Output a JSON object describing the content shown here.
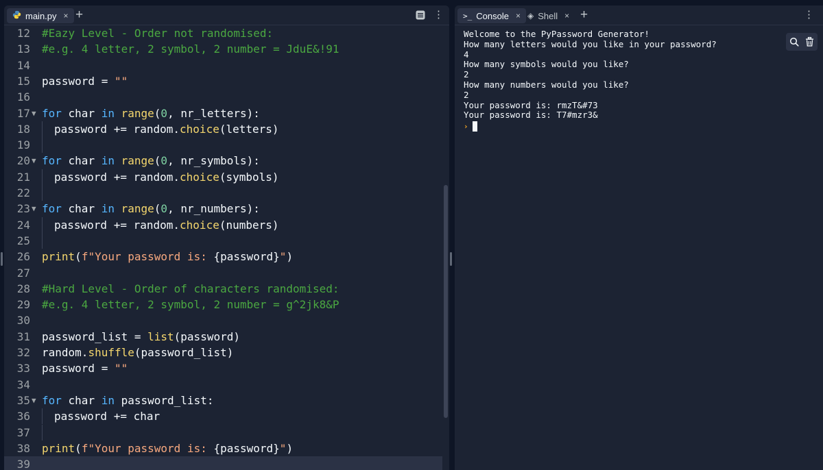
{
  "editor": {
    "tab_label": "main.py",
    "close_glyph": "×",
    "add_glyph": "+",
    "menu_glyph": "⋮",
    "icons": {
      "file": "python-icon",
      "panel": "list-panel-icon"
    },
    "lines": [
      {
        "n": "12",
        "fold": false,
        "indent": 0,
        "tokens": [
          [
            "comment",
            "#Eazy Level - Order not randomised:"
          ]
        ]
      },
      {
        "n": "13",
        "fold": false,
        "indent": 0,
        "tokens": [
          [
            "comment",
            "#e.g. 4 letter, 2 symbol, 2 number = JduE&!91"
          ]
        ]
      },
      {
        "n": "14",
        "fold": false,
        "indent": 0,
        "tokens": []
      },
      {
        "n": "15",
        "fold": false,
        "indent": 0,
        "tokens": [
          [
            "plain",
            "password = "
          ],
          [
            "str",
            "\"\""
          ]
        ]
      },
      {
        "n": "16",
        "fold": false,
        "indent": 0,
        "tokens": []
      },
      {
        "n": "17",
        "fold": true,
        "indent": 0,
        "tokens": [
          [
            "kw",
            "for"
          ],
          [
            "plain",
            " char "
          ],
          [
            "kw",
            "in"
          ],
          [
            "plain",
            " "
          ],
          [
            "fn",
            "range"
          ],
          [
            "plain",
            "("
          ],
          [
            "num",
            "0"
          ],
          [
            "plain",
            ", nr_letters):"
          ]
        ]
      },
      {
        "n": "18",
        "fold": false,
        "indent": 1,
        "tokens": [
          [
            "plain",
            "password += random."
          ],
          [
            "fn",
            "choice"
          ],
          [
            "plain",
            "(letters)"
          ]
        ]
      },
      {
        "n": "19",
        "fold": false,
        "indent": 1,
        "tokens": []
      },
      {
        "n": "20",
        "fold": true,
        "indent": 0,
        "tokens": [
          [
            "kw",
            "for"
          ],
          [
            "plain",
            " char "
          ],
          [
            "kw",
            "in"
          ],
          [
            "plain",
            " "
          ],
          [
            "fn",
            "range"
          ],
          [
            "plain",
            "("
          ],
          [
            "num",
            "0"
          ],
          [
            "plain",
            ", nr_symbols):"
          ]
        ]
      },
      {
        "n": "21",
        "fold": false,
        "indent": 1,
        "tokens": [
          [
            "plain",
            "password += random."
          ],
          [
            "fn",
            "choice"
          ],
          [
            "plain",
            "(symbols)"
          ]
        ]
      },
      {
        "n": "22",
        "fold": false,
        "indent": 1,
        "tokens": []
      },
      {
        "n": "23",
        "fold": true,
        "indent": 0,
        "tokens": [
          [
            "kw",
            "for"
          ],
          [
            "plain",
            " char "
          ],
          [
            "kw",
            "in"
          ],
          [
            "plain",
            " "
          ],
          [
            "fn",
            "range"
          ],
          [
            "plain",
            "("
          ],
          [
            "num",
            "0"
          ],
          [
            "plain",
            ", nr_numbers):"
          ]
        ]
      },
      {
        "n": "24",
        "fold": false,
        "indent": 1,
        "tokens": [
          [
            "plain",
            "password += random."
          ],
          [
            "fn",
            "choice"
          ],
          [
            "plain",
            "(numbers)"
          ]
        ]
      },
      {
        "n": "25",
        "fold": false,
        "indent": 1,
        "tokens": []
      },
      {
        "n": "26",
        "fold": false,
        "indent": 0,
        "tokens": [
          [
            "fn",
            "print"
          ],
          [
            "plain",
            "("
          ],
          [
            "str",
            "f\"Your password is: "
          ],
          [
            "plain",
            "{password}"
          ],
          [
            "str",
            "\""
          ],
          [
            "plain",
            ")"
          ]
        ]
      },
      {
        "n": "27",
        "fold": false,
        "indent": 0,
        "tokens": []
      },
      {
        "n": "28",
        "fold": false,
        "indent": 0,
        "tokens": [
          [
            "comment",
            "#Hard Level - Order of characters randomised:"
          ]
        ]
      },
      {
        "n": "29",
        "fold": false,
        "indent": 0,
        "tokens": [
          [
            "comment",
            "#e.g. 4 letter, 2 symbol, 2 number = g^2jk8&P"
          ]
        ]
      },
      {
        "n": "30",
        "fold": false,
        "indent": 0,
        "tokens": []
      },
      {
        "n": "31",
        "fold": false,
        "indent": 0,
        "tokens": [
          [
            "plain",
            "password_list = "
          ],
          [
            "fn",
            "list"
          ],
          [
            "plain",
            "(password)"
          ]
        ]
      },
      {
        "n": "32",
        "fold": false,
        "indent": 0,
        "tokens": [
          [
            "plain",
            "random."
          ],
          [
            "fn",
            "shuffle"
          ],
          [
            "plain",
            "(password_list)"
          ]
        ]
      },
      {
        "n": "33",
        "fold": false,
        "indent": 0,
        "tokens": [
          [
            "plain",
            "password = "
          ],
          [
            "str",
            "\"\""
          ]
        ]
      },
      {
        "n": "34",
        "fold": false,
        "indent": 0,
        "tokens": []
      },
      {
        "n": "35",
        "fold": true,
        "indent": 0,
        "tokens": [
          [
            "kw",
            "for"
          ],
          [
            "plain",
            " char "
          ],
          [
            "kw",
            "in"
          ],
          [
            "plain",
            " password_list:"
          ]
        ]
      },
      {
        "n": "36",
        "fold": false,
        "indent": 1,
        "tokens": [
          [
            "plain",
            "password += char"
          ]
        ]
      },
      {
        "n": "37",
        "fold": false,
        "indent": 1,
        "tokens": []
      },
      {
        "n": "38",
        "fold": false,
        "indent": 0,
        "tokens": [
          [
            "fn",
            "print"
          ],
          [
            "plain",
            "("
          ],
          [
            "str",
            "f\"Your password is: "
          ],
          [
            "plain",
            "{password}"
          ],
          [
            "str",
            "\""
          ],
          [
            "plain",
            ")"
          ]
        ]
      },
      {
        "n": "39",
        "fold": false,
        "indent": 0,
        "tokens": [],
        "current": true
      }
    ],
    "fold_glyph": "▼"
  },
  "console": {
    "tabs": [
      {
        "label": "Console",
        "glyph": ">_",
        "icon": "terminal-icon",
        "active": true
      },
      {
        "label": "Shell",
        "glyph": "◈",
        "icon": "shell-icon",
        "active": false
      }
    ],
    "close_glyph": "×",
    "add_glyph": "+",
    "menu_glyph": "⋮",
    "output": [
      "Welcome to the PyPassword Generator!",
      "How many letters would you like in your password?",
      "4",
      "How many symbols would you like?",
      "2",
      "How many numbers would you like?",
      "2",
      "Your password is: rmzT&#73",
      "Your password is: T7#mzr3&"
    ],
    "prompt_glyph": "›",
    "tools": {
      "search": "search-icon",
      "clear": "trash-icon"
    }
  },
  "colors": {
    "background": "#0e1525",
    "panel": "#1c2333",
    "comment": "#4ba841",
    "keyword": "#56b6ff",
    "function": "#f5d76e",
    "string": "#f8a97f"
  }
}
